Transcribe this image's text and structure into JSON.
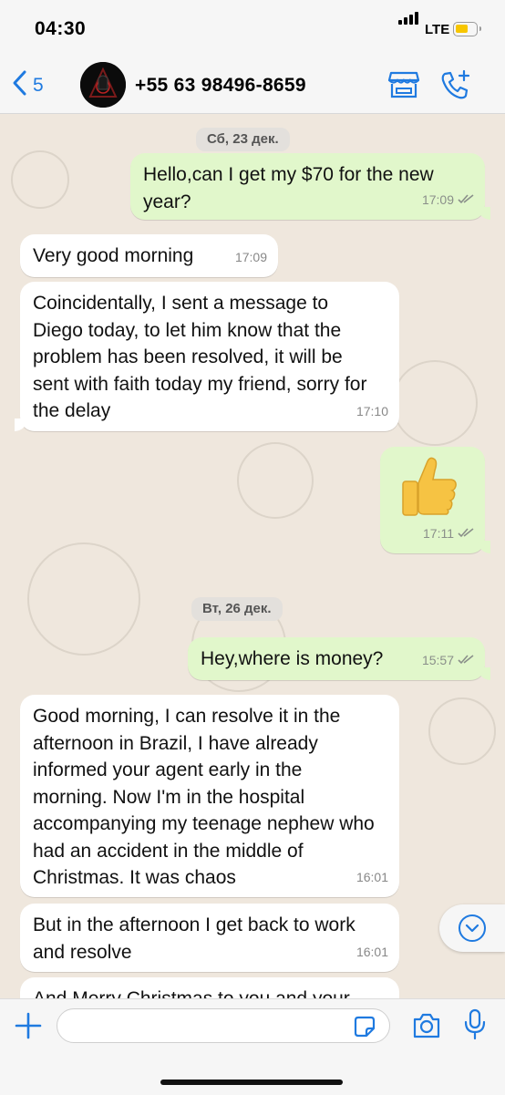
{
  "status_bar": {
    "time": "04:30",
    "network": "LTE",
    "battery_level": 0.45,
    "battery_color": "#f7c600"
  },
  "header": {
    "back_count": "5",
    "contact_name": "+55 63 98496-8659",
    "icons": [
      "back-chevron-icon",
      "store-icon",
      "add-call-icon"
    ],
    "accent_color": "#1f7ae0"
  },
  "chat": {
    "dates": [
      "Сб, 23 дек.",
      "Вт, 26 дек."
    ],
    "messages": [
      {
        "direction": "out",
        "text": "Hello,can I get my $70 for the new year?",
        "time": "17:09",
        "status": "read"
      },
      {
        "direction": "in",
        "text": "Very good morning",
        "time": "17:09"
      },
      {
        "direction": "in",
        "text": "Coincidentally, I sent a message to Diego today, to let him know that the problem has been resolved, it will be sent with faith today my friend, sorry for the delay",
        "time": "17:10"
      },
      {
        "direction": "out",
        "text": "",
        "emoji": "thumbs-up",
        "time": "17:11",
        "status": "read"
      },
      {
        "direction": "out",
        "text": "Hey,where is money?",
        "time": "15:57",
        "status": "read"
      },
      {
        "direction": "in",
        "text": "Good morning, I can resolve it in the afternoon in Brazil, I have already informed your agent early in the morning. Now I'm in the hospital accompanying my teenage nephew who had an accident in the middle of Christmas. It was chaos",
        "time": "16:01"
      },
      {
        "direction": "in",
        "text": "But in the afternoon I get back to work and resolve",
        "time": "16:01"
      },
      {
        "direction": "in",
        "text": "And Merry Christmas to you and your",
        "time": ""
      }
    ],
    "colors": {
      "outgoing": "#e1f7cb",
      "incoming": "#ffffff",
      "wallpaper": "#efe7dd"
    }
  },
  "input_bar": {
    "placeholder": "",
    "icons": [
      "plus-icon",
      "sticker-icon",
      "camera-icon",
      "microphone-icon"
    ]
  }
}
